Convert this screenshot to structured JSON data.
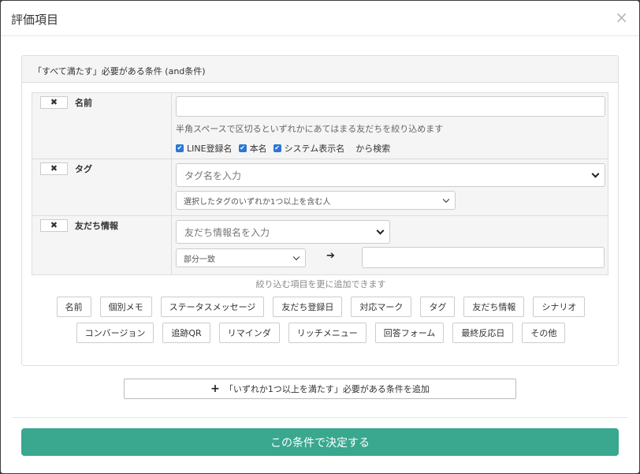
{
  "modal": {
    "title": "評価項目",
    "close": "×"
  },
  "panel": {
    "heading": "「すべて満たす」必要がある条件 (and条件)"
  },
  "conditions": {
    "name": {
      "remove": "✖",
      "label": "名前",
      "input_value": "",
      "help": "半角スペースで区切るといずれかにあてはまる友だちを絞り込めます",
      "checks": [
        "LINE登録名",
        "本名",
        "システム表示名"
      ],
      "suffix": "から検索"
    },
    "tag": {
      "remove": "✖",
      "label": "タグ",
      "placeholder": "タグ名を入力",
      "match_mode": "選択したタグのいずれか1つ以上を含む人"
    },
    "friend_info": {
      "remove": "✖",
      "label": "友だち情報",
      "placeholder": "友だち情報名を入力",
      "match_mode": "部分一致",
      "arrow": "➔",
      "value": ""
    }
  },
  "add_hint": "絞り込む項目を更に追加できます",
  "add_items_row1": [
    "名前",
    "個別メモ",
    "ステータスメッセージ",
    "友だち登録日",
    "対応マーク",
    "タグ",
    "友だち情報",
    "シナリオ"
  ],
  "add_items_row2": [
    "コンバージョン",
    "追跡QR",
    "リマインダ",
    "リッチメニュー",
    "回答フォーム",
    "最終反応日",
    "その他"
  ],
  "or_button": {
    "plus": "+",
    "label": "「いずれか1つ以上を満たす」必要がある条件を追加"
  },
  "submit_label": "この条件で決定する",
  "colors": {
    "primary": "#3aa78f",
    "checkbox": "#2a78d4"
  }
}
